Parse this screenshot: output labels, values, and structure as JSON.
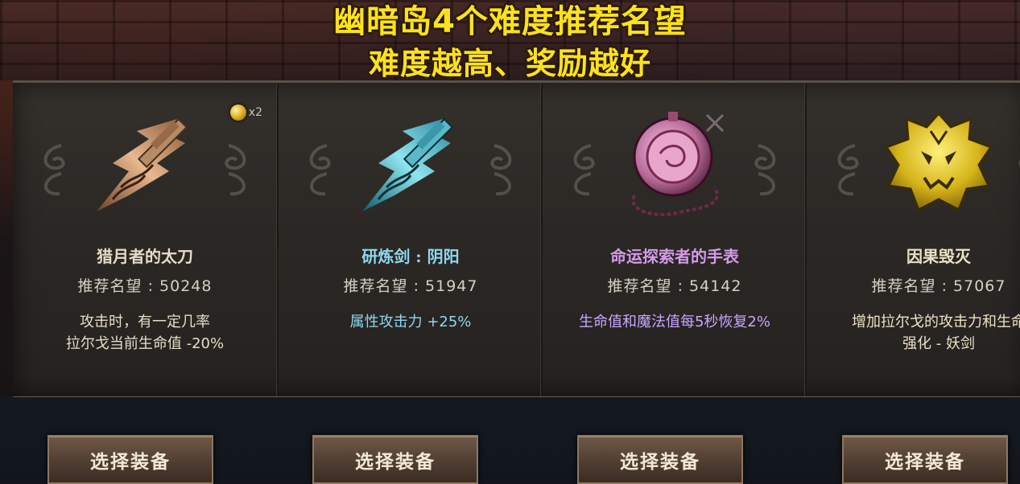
{
  "header": {
    "title_line1": "幽暗岛4个难度推荐名望",
    "title_line2": "难度越高、奖励越好"
  },
  "badge": {
    "icon": "gold-coin-icon",
    "count": "x2"
  },
  "cards": [
    {
      "name": "猎月者的太刀",
      "fame": "推荐名望 : 50248",
      "desc": "攻击时，有一定几率\n拉尔戈当前生命值 -20%",
      "icon": "bronze-sword-icon",
      "name_color": "#e6dcc8",
      "desc_color": "#e6dcc8"
    },
    {
      "name": "研炼剑 : 阴阳",
      "fame": "推荐名望 : 51947",
      "desc": "属性攻击力 +25%",
      "icon": "cyan-sword-icon",
      "name_color": "#8fd8ef",
      "desc_color": "#8fd8ef"
    },
    {
      "name": "命运探索者的手表",
      "fame": "推荐名望 : 54142",
      "desc": "生命值和魔法值每5秒恢复2%",
      "icon": "pocket-watch-icon",
      "name_color": "#d49be8",
      "desc_color": "#c9a6ff"
    },
    {
      "name": "因果毁灭",
      "fame": "推荐名望 : 57067",
      "desc": "增加拉尔戈的攻击力和生命\n强化 - 妖剑",
      "icon": "golden-emblem-icon",
      "name_color": "#ece2c6",
      "desc_color": "#ece2c6"
    }
  ],
  "buttons": [
    {
      "label": "选择装备"
    },
    {
      "label": "选择装备"
    },
    {
      "label": "选择装备"
    },
    {
      "label": "选择装备"
    }
  ]
}
